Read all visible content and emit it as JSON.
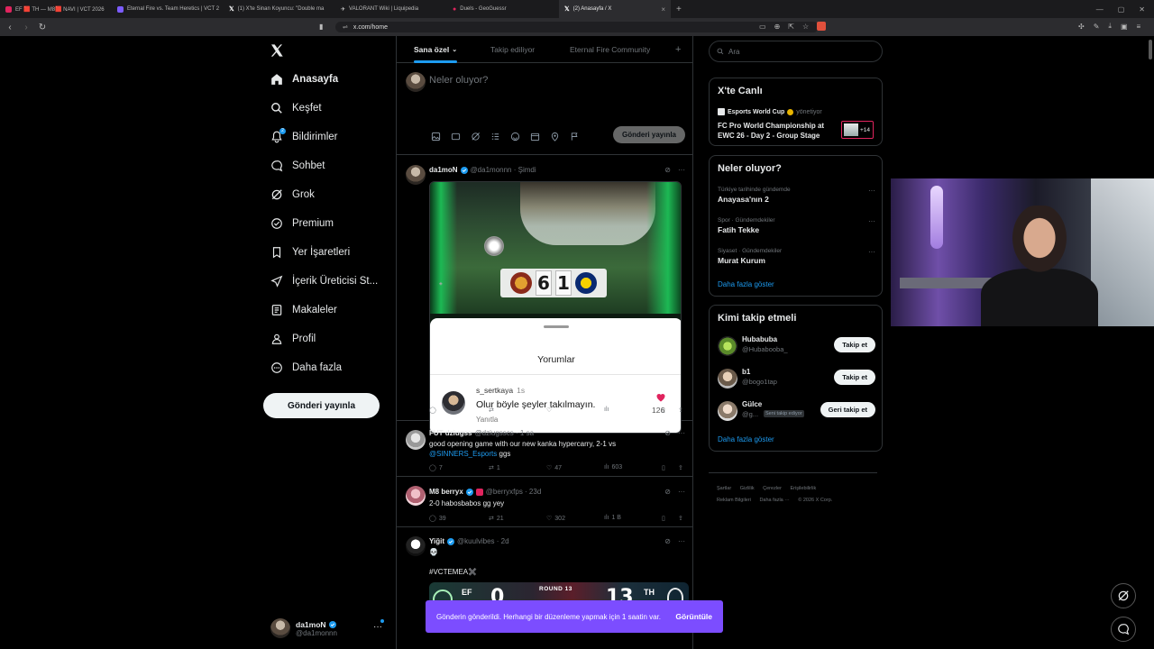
{
  "browser": {
    "tabs": [
      {
        "label": "EF 🟥 TH — M8🟥 NAVI | VCT 2026",
        "color": "#e0245e"
      },
      {
        "label": "Eternal Fire vs. Team Heretics | VCT 2",
        "color": "#7c5cff"
      },
      {
        "label": "(1) X'te Sinan Koyuncu: \"Double ma",
        "color": "#ffffff"
      },
      {
        "label": "VALORANT Wiki | Liquipedia",
        "color": "#dddddd"
      },
      {
        "label": "Duels - GeoGuessr",
        "color": "#e0245e"
      },
      {
        "label": "(2) Anasayfa / X",
        "color": "#ffffff"
      }
    ],
    "url": "x.com/home"
  },
  "sidebar": {
    "items": [
      {
        "label": "Anasayfa",
        "icon": "home-icon"
      },
      {
        "label": "Keşfet",
        "icon": "search-icon"
      },
      {
        "label": "Bildirimler",
        "icon": "bell-icon",
        "badge": "2"
      },
      {
        "label": "Sohbet",
        "icon": "chat-bubble-icon"
      },
      {
        "label": "Grok",
        "icon": "grok-icon"
      },
      {
        "label": "Premium",
        "icon": "premium-check-icon"
      },
      {
        "label": "Yer İşaretleri",
        "icon": "bookmark-icon"
      },
      {
        "label": "İçerik Üreticisi St...",
        "icon": "rocket-icon"
      },
      {
        "label": "Makaleler",
        "icon": "article-icon"
      },
      {
        "label": "Profil",
        "icon": "person-icon"
      },
      {
        "label": "Daha fazla",
        "icon": "more-circle-icon"
      }
    ],
    "post_button": "Gönderi yayınla",
    "account": {
      "name": "da1moN",
      "handle": "@da1monnn"
    }
  },
  "feed": {
    "tabs": [
      "Sana özel",
      "Takip ediliyor",
      "Eternal Fire Community"
    ],
    "compose_placeholder": "Neler oluyor?",
    "compose_button": "Gönderi yayınla",
    "posts": [
      {
        "name": "da1moN",
        "handle": "@da1monnn · Şimdi",
        "score_home": "6",
        "score_away": "1",
        "comments_sheet": {
          "title": "Yorumlar",
          "user": "s_sertkaya",
          "time": "1s",
          "text": "Olur böyle şeyler takılmayın.",
          "reply": "Yanıtla",
          "likes": "126"
        }
      },
      {
        "name": "FUT dziugss",
        "handle": "@dziugsscs · 1 sa",
        "text_line1": "good opening game with our new kanka hypercarry, 2-1 vs",
        "mention": "@SINNERS_Esports",
        "text_line2": " ggs",
        "replies": "7",
        "reposts": "1",
        "likes": "47",
        "views": "603"
      },
      {
        "name": "M8 berryx",
        "handle": "@berryxfps · 23d",
        "text": "2-0 habosbabos gg yey",
        "replies": "39",
        "reposts": "21",
        "likes": "302",
        "views": "1 B"
      },
      {
        "name": "Yiğit",
        "handle": "@kuulvibes · 2d",
        "emoji": "💀",
        "hashtag": "#VCTEMEA✖️",
        "score_left": "0",
        "score_right": "13",
        "team_left": "EF",
        "team_right": "TH",
        "round_label": "ROUND 13"
      }
    ]
  },
  "toast": {
    "message": "Gönderin gönderildi. Herhangi bir düzenleme yapmak için 1 saatin var.",
    "action": "Görüntüle"
  },
  "right": {
    "search_placeholder": "Ara",
    "live": {
      "title": "X'te Canlı",
      "host": "Esports World Cup",
      "host_suffix": "yönetiyor",
      "event": "FC Pro World Championship at EWC 26 - Day 2 - Group Stage",
      "extra": "+14"
    },
    "trends": {
      "title": "Neler oluyor?",
      "items": [
        {
          "category": "Türkiye tarihinde gündemde",
          "topic": "Anayasa'nın 2"
        },
        {
          "category": "Spor · Gündemdekiler",
          "topic": "Fatih Tekke"
        },
        {
          "category": "Siyaset · Gündemdekiler",
          "topic": "Murat Kurum"
        }
      ],
      "show_more": "Daha fazla göster"
    },
    "who_to_follow": {
      "title": "Kimi takip etmeli",
      "items": [
        {
          "name": "Hubabuba",
          "handle": "@Hubabooba_",
          "button": "Takip et"
        },
        {
          "name": "b1",
          "handle": "@bogo1tap",
          "button": "Takip et"
        },
        {
          "name": "Gülce",
          "handle": "@g...",
          "badge": "Seni takip ediyor",
          "button": "Geri takip et"
        }
      ],
      "show_more": "Daha fazla göster"
    },
    "footer": [
      "Şartlar",
      "Gizlilik",
      "Çerezler",
      "Erişilebilirlik",
      "Reklam Bilgileri",
      "Daha fazla ···",
      "© 2026 X Corp."
    ]
  },
  "colors": {
    "accent": "#1d9bf0",
    "toast": "#7c4dff",
    "border": "#2f3336",
    "muted": "#71767b"
  }
}
